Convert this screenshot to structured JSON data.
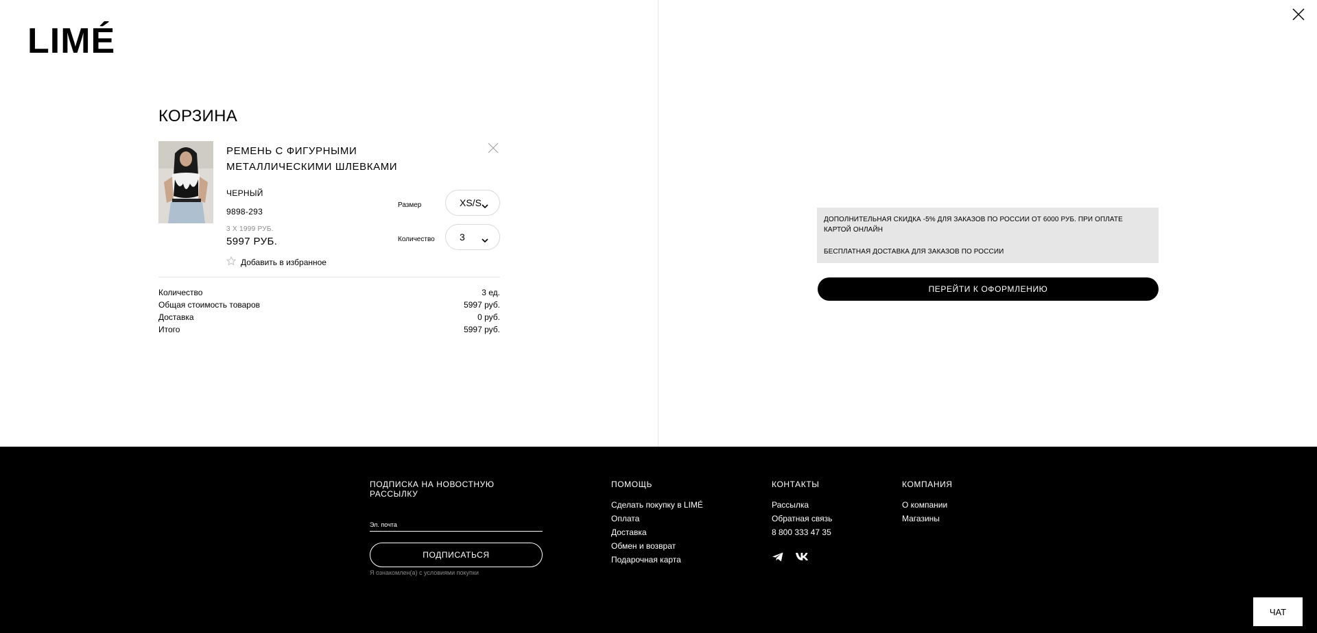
{
  "brand": {
    "logo": "LIMÉ"
  },
  "cart": {
    "title": "КОРЗИНА",
    "item": {
      "name": "РЕМЕНЬ С ФИГУРНЫМИ МЕТАЛЛИЧЕСКИМИ ШЛЕВКАМИ",
      "color": "ЧЕРНЫЙ",
      "sku": "9898-293",
      "unit_price": "3 X 1999 РУБ.",
      "total_price": "5997 РУБ.",
      "favorite_label": "Добавить в избранное",
      "size_label": "Размер",
      "size_value": "XS/S",
      "qty_label": "Количество",
      "qty_value": "3"
    },
    "summary": [
      {
        "label": "Количество",
        "value": "3 ед."
      },
      {
        "label": "Общая стоимость товаров",
        "value": "5997 руб."
      },
      {
        "label": "Доставка",
        "value": "0 руб."
      },
      {
        "label": "Итого",
        "value": "5997 руб."
      }
    ]
  },
  "promo": {
    "line1": "ДОПОЛНИТЕЛЬНАЯ СКИДКА -5% ДЛЯ ЗАКАЗОВ ПО РОССИИ ОТ 6000 РУБ. ПРИ ОПЛАТЕ КАРТОЙ ОНЛАЙН",
    "line2": "БЕСПЛАТНАЯ ДОСТАВКА ДЛЯ ЗАКАЗОВ ПО РОССИИ"
  },
  "checkout_label": "ПЕРЕЙТИ К ОФОРМЛЕНИЮ",
  "footer": {
    "newsletter": {
      "title": "ПОДПИСКА НА НОВОСТНУЮ РАССЫЛКУ",
      "email_placeholder": "Эл. почта",
      "button": "ПОДПИСАТЬСЯ",
      "terms": "Я ознакомлен(а) с условиями покупки"
    },
    "help": {
      "title": "ПОМОЩЬ",
      "links": [
        "Сделать покупку в LIMÉ",
        "Оплата",
        "Доставка",
        "Обмен и возврат",
        "Подарочная карта"
      ]
    },
    "contacts": {
      "title": "КОНТАКТЫ",
      "links": [
        "Рассылка",
        "Обратная связь",
        "8 800 333 47 35"
      ]
    },
    "company": {
      "title": "КОМПАНИЯ",
      "links": [
        "О компании",
        "Магазины"
      ]
    },
    "chat": "ЧАТ"
  },
  "colors": {
    "footer_bg": "#000000",
    "promo_bg": "#e6e6e6",
    "button_bg": "#000000"
  },
  "icons": {
    "close": "close-icon",
    "remove": "remove-item-icon",
    "star": "star-icon",
    "chevron": "chevron-down-icon",
    "telegram": "telegram-icon",
    "vk": "vk-icon"
  }
}
